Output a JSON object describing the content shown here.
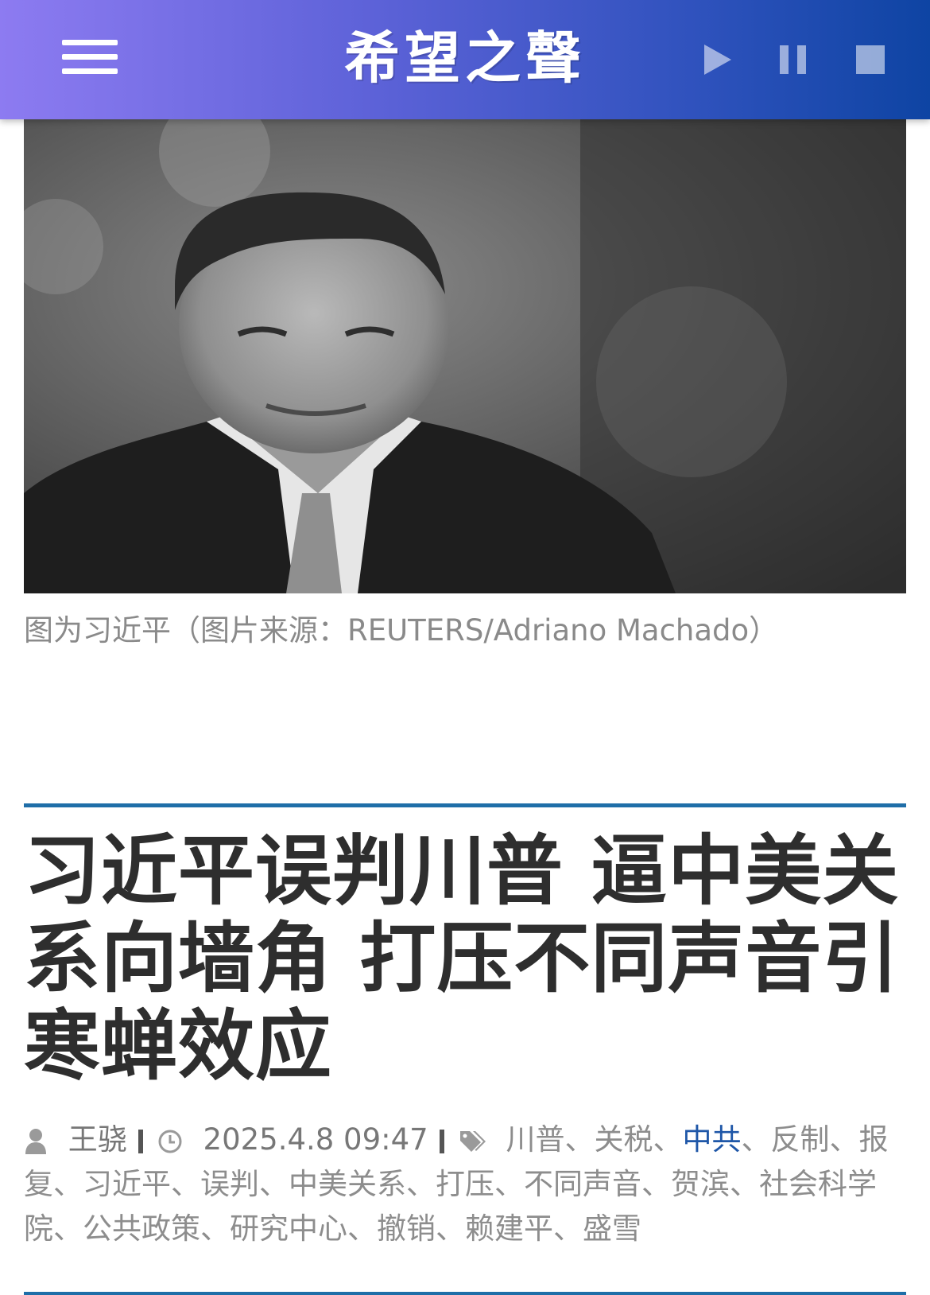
{
  "header": {
    "logo_text": "希望之聲",
    "menu_icon": "hamburger-menu-icon",
    "controls": [
      "play-icon",
      "pause-icon",
      "stop-icon"
    ]
  },
  "article": {
    "image_caption": "图为习近平（图片来源：REUTERS/Adriano Machado）",
    "title": "习近平误判川普 逼中美关系向墙角 打压不同声音引寒蝉效应",
    "author": "王骁",
    "datetime": "2025.4.8 09:47",
    "tags": [
      {
        "label": "川普",
        "active": false
      },
      {
        "label": "关税",
        "active": false
      },
      {
        "label": "中共",
        "active": true
      },
      {
        "label": "反制",
        "active": false
      },
      {
        "label": "报复",
        "active": false
      },
      {
        "label": "习近平",
        "active": false
      },
      {
        "label": "误判",
        "active": false
      },
      {
        "label": "中美关系",
        "active": false
      },
      {
        "label": "打压",
        "active": false
      },
      {
        "label": "不同声音",
        "active": false
      },
      {
        "label": "贺滨",
        "active": false
      },
      {
        "label": "社会科学院",
        "active": false
      },
      {
        "label": "公共政策",
        "active": false
      },
      {
        "label": "研究中心",
        "active": false
      },
      {
        "label": "撤销",
        "active": false
      },
      {
        "label": "赖建平",
        "active": false
      },
      {
        "label": "盛雪",
        "active": false
      }
    ],
    "tag_separator": "、"
  },
  "colors": {
    "header_gradient_start": "#8d7bf1",
    "header_gradient_end": "#0e44a3",
    "rule": "#1f6ea8",
    "active_tag": "#1f57a8",
    "title": "#2e2e2e",
    "meta": "#8d8d8d"
  }
}
